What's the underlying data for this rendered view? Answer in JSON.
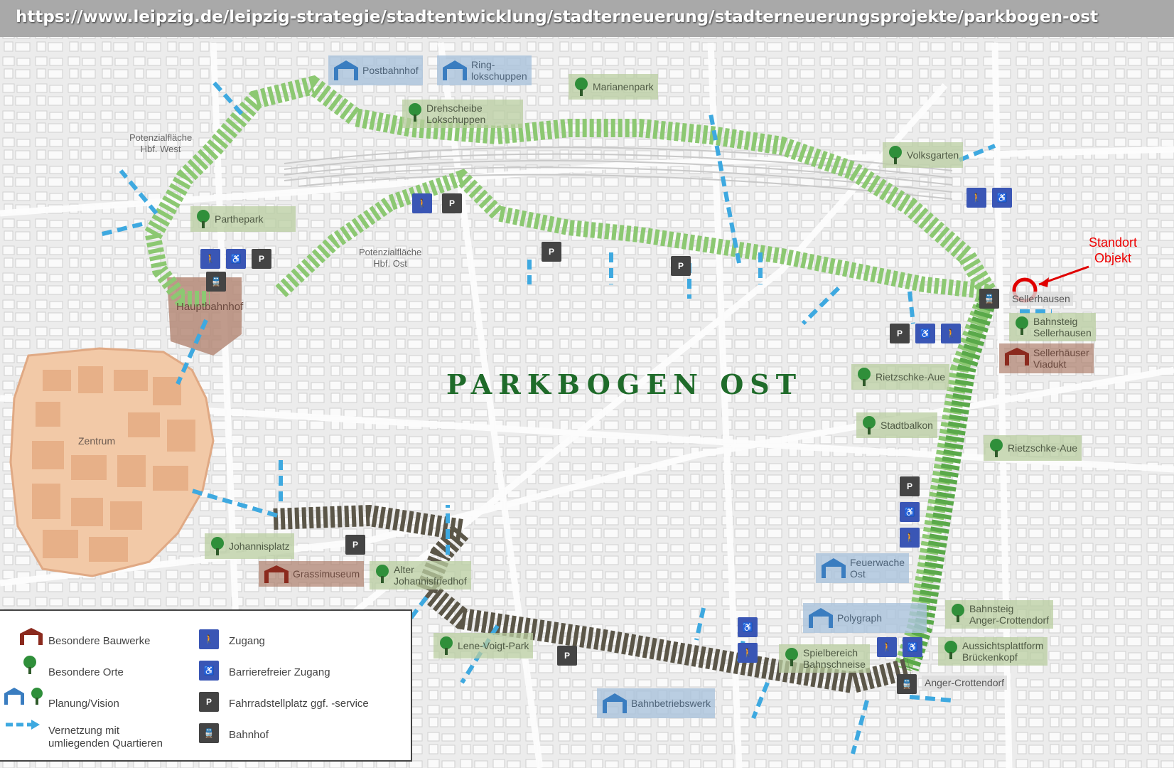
{
  "url": "https://www.leipzig.de/leipzig-strategie/stadtentwicklung/stadterneuerung/stadterneuerungsprojekte/parkbogen-ost",
  "title": "PARKBOGEN OST",
  "annotation": {
    "line1": "Standort",
    "line2": "Objekt"
  },
  "potential_areas": [
    {
      "line1": "Potenzialfläche",
      "line2": "Hbf. West"
    },
    {
      "line1": "Potenzialfläche",
      "line2": "Hbf. Ost"
    }
  ],
  "district_label": "Zentrum",
  "special_places": [
    {
      "label": "Marianenpark"
    },
    {
      "label": "Drehscheibe\nLokschuppen"
    },
    {
      "label": "Volksgarten"
    },
    {
      "label": "Parthepark"
    },
    {
      "label": "Bahnsteig\nSellerhausen"
    },
    {
      "label": "Rietzschke-Aue"
    },
    {
      "label": "Stadtbalkon"
    },
    {
      "label": "Rietzschke-Aue"
    },
    {
      "label": "Johannisplatz"
    },
    {
      "label": "Alter\nJohannisfriedhof"
    },
    {
      "label": "Lene-Voigt-Park"
    },
    {
      "label": "Bahnsteig\nAnger-Crottendorf"
    },
    {
      "label": "Aussichtsplattform\nBrückenkopf"
    },
    {
      "label": "Spielbereich\nBahnschneise"
    }
  ],
  "planning": [
    {
      "label": "Postbahnhof"
    },
    {
      "label": "Ring-\nlokschuppen"
    },
    {
      "label": "Feuerwache\nOst"
    },
    {
      "label": "Polygraph"
    },
    {
      "label": "Bahnbetriebswerk"
    }
  ],
  "buildings": [
    {
      "label": "Hauptbahnhof"
    },
    {
      "label": "Grassimuseum"
    },
    {
      "label": "Sellerhäuser\nViadukt"
    }
  ],
  "stations": [
    {
      "label": "Sellerhausen"
    },
    {
      "label": "Anger-Crottendorf"
    }
  ],
  "legend": {
    "special_buildings": "Besondere Bauwerke",
    "special_places": "Besondere Orte",
    "planning": "Planung/Vision",
    "network": "Vernetzung mit\numliegenden Quartieren",
    "access": "Zugang",
    "barrier_free": "Barrierefreier Zugang",
    "bike": "Fahrradstellplatz ggf. -service",
    "station": "Bahnhof"
  },
  "icon_names": [
    "building-icon",
    "tree-icon",
    "plan-icon",
    "access-icon",
    "wheelchair-icon",
    "bike-parking-icon",
    "train-station-icon",
    "arrow-icon"
  ],
  "colors": {
    "park_light": "#8cc872",
    "park_mid": "#5aa94a",
    "park_dark": "#5b5648",
    "network": "#3ea9e0",
    "center": "#f2c9a7",
    "building": "#9b6a58",
    "plan": "#aac3dc",
    "place": "#c3d6ad",
    "marker": "#e00000"
  }
}
